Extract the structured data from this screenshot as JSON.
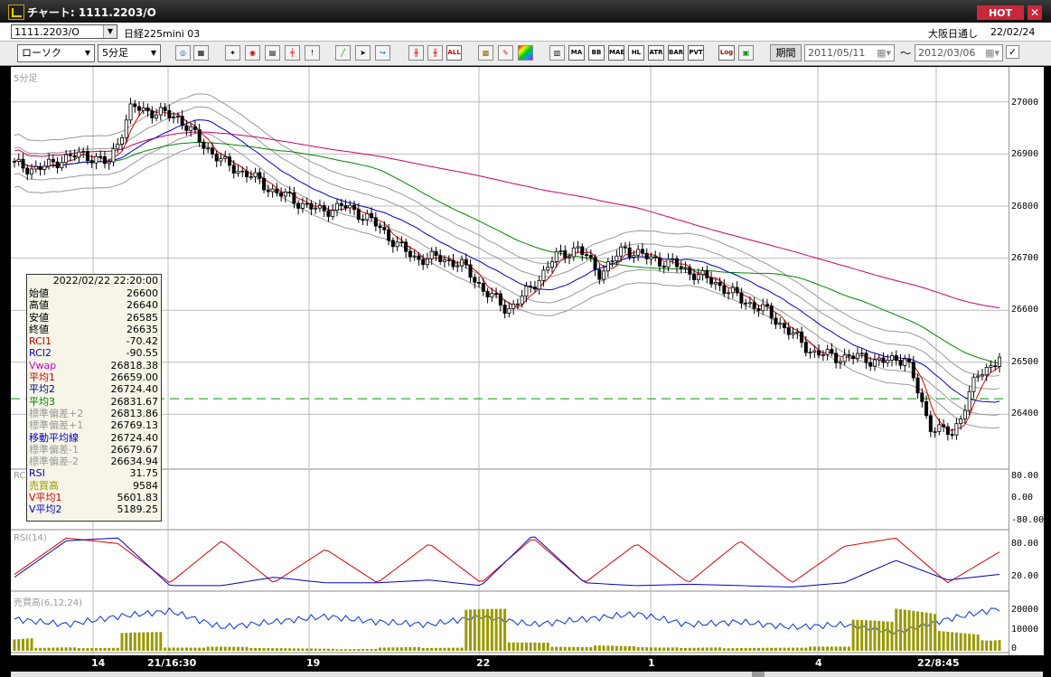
{
  "window": {
    "title": "チャート: 1111.2203/O",
    "hot_label": "HOT",
    "close_glyph": "✕"
  },
  "header": {
    "symbol_code": "1111.2203/O",
    "symbol_name": "日経225mini 03",
    "session": "大阪日通し",
    "date": "22/02/24"
  },
  "toolbar": {
    "chart_type": "ローソク",
    "interval": "5分足",
    "buttons": [
      "zoom",
      "table",
      "cursor",
      "analysis",
      "chart",
      "trend",
      "signal",
      "line-draw",
      "pointer",
      "fibonacci",
      "candle-a",
      "candle-b",
      "all",
      "pattern",
      "settings",
      "palette",
      "index",
      "MA",
      "BB",
      "MAE",
      "HL",
      "ATR",
      "BAR",
      "PVT",
      "Log",
      "export"
    ],
    "text_buttons": {
      "ma": "MA",
      "bb": "BB",
      "mae": "MAE",
      "hl": "HL",
      "atr": "ATR",
      "bar": "BAR",
      "pvt": "PVT",
      "log": "Log",
      "all": "ALL"
    },
    "period_label": "期間",
    "date_from": "2011/05/11",
    "tilde": "～",
    "date_to": "2012/03/06",
    "check": "✓"
  },
  "panels": {
    "price_label": "5分足",
    "rci_label": "RCI",
    "rsi_label": "RSI(14)",
    "volume_label": "売買高(6,12,24)"
  },
  "y_axis": {
    "price": [
      "27000",
      "26900",
      "26800",
      "26700",
      "26600",
      "26500",
      "26400"
    ],
    "rci": [
      "80.00",
      "0.00",
      "-80.00"
    ],
    "rsi": [
      "80.00",
      "20.00"
    ],
    "volume": [
      "20000",
      "10000",
      "0"
    ]
  },
  "x_axis": [
    "14",
    "21/16:30",
    "19",
    "22",
    "1",
    "4",
    "22/8:45"
  ],
  "info": {
    "datetime": "2022/02/22  22:20:00",
    "rows": [
      {
        "k": "始値",
        "v": "26600",
        "color": "#000000"
      },
      {
        "k": "高値",
        "v": "26640",
        "color": "#000000"
      },
      {
        "k": "安値",
        "v": "26585",
        "color": "#000000"
      },
      {
        "k": "終値",
        "v": "26635",
        "color": "#000000"
      },
      {
        "k": "RCI1",
        "v": "-70.42",
        "color": "#cc0000"
      },
      {
        "k": "RCI2",
        "v": "-90.55",
        "color": "#0000cc"
      },
      {
        "k": "Vwap",
        "v": "26818.38",
        "color": "#cc00cc"
      },
      {
        "k": "平均1",
        "v": "26659.00",
        "color": "#cc0000"
      },
      {
        "k": "平均2",
        "v": "26724.40",
        "color": "#000080"
      },
      {
        "k": "平均3",
        "v": "26831.67",
        "color": "#008000"
      },
      {
        "k": "標準偏差+2",
        "v": "26813.86",
        "color": "#999999"
      },
      {
        "k": "標準偏差+1",
        "v": "26769.13",
        "color": "#999999"
      },
      {
        "k": "移動平均線",
        "v": "26724.40",
        "color": "#0000cc"
      },
      {
        "k": "標準偏差-1",
        "v": "26679.67",
        "color": "#999999"
      },
      {
        "k": "標準偏差-2",
        "v": "26634.94",
        "color": "#999999"
      },
      {
        "k": "RSI",
        "v": "31.75",
        "color": "#0000cc"
      },
      {
        "k": "売買高",
        "v": "9584",
        "color": "#999900"
      },
      {
        "k": "V平均1",
        "v": "5601.83",
        "color": "#cc0000"
      },
      {
        "k": "V平均2",
        "v": "5189.25",
        "color": "#0000cc"
      }
    ]
  },
  "colors": {
    "up_candle": "#ffffff",
    "down_candle": "#000000",
    "ma1": "#e00000",
    "ma2": "#0000cc",
    "ma3": "#008800",
    "vwap": "#cc0066",
    "band": "#999999",
    "rci1": "#e00000",
    "rci2": "#0000cc",
    "rsi": "#0033dd",
    "volume": "#999900",
    "dashed_level": "#009900"
  },
  "chart_data": [
    {
      "type": "candlestick",
      "title": "5分足",
      "ylim": [
        26300,
        27050
      ],
      "reference_level": 26430,
      "close_path": [
        26880,
        26870,
        26890,
        26900,
        26880,
        26990,
        26980,
        26970,
        26920,
        26880,
        26860,
        26830,
        26810,
        26790,
        26800,
        26780,
        26740,
        26700,
        26700,
        26690,
        26640,
        26600,
        26640,
        26700,
        26720,
        26670,
        26720,
        26700,
        26690,
        26670,
        26650,
        26620,
        26600,
        26560,
        26520,
        26510,
        26510,
        26500,
        26510,
        26380,
        26360,
        26470,
        26510
      ]
    },
    {
      "type": "line",
      "title": "RCI",
      "ylim": [
        -100,
        100
      ],
      "series": [
        {
          "name": "RCI1",
          "values": [
            -50,
            80,
            60,
            -80,
            70,
            -80,
            40,
            -80,
            60,
            -80,
            80,
            -80,
            60,
            -80,
            70,
            -80,
            50,
            80,
            -80,
            30
          ]
        },
        {
          "name": "RCI2",
          "values": [
            -60,
            70,
            80,
            -90,
            -90,
            -60,
            -80,
            -80,
            -70,
            -90,
            90,
            -80,
            -90,
            -85,
            -90,
            -95,
            -80,
            0,
            -70,
            -50
          ]
        }
      ]
    },
    {
      "type": "line",
      "title": "RSI(14)",
      "ylim": [
        0,
        100
      ],
      "series": [
        {
          "name": "RSI",
          "values": [
            55,
            45,
            60,
            70,
            40,
            50,
            60,
            50,
            45,
            60,
            45,
            55,
            65,
            45,
            50,
            40,
            45,
            30,
            55,
            75
          ]
        }
      ]
    },
    {
      "type": "bar",
      "title": "売買高(6,12,24)",
      "ylim": [
        0,
        25000
      ],
      "values": [
        9000,
        2000,
        1500,
        9000,
        1500,
        2000,
        1500,
        1500,
        1200,
        2000,
        1500,
        20000,
        4000,
        2000,
        3000,
        2500,
        2000,
        1500,
        1500,
        2000,
        15000,
        22000,
        12000,
        8000
      ]
    }
  ]
}
